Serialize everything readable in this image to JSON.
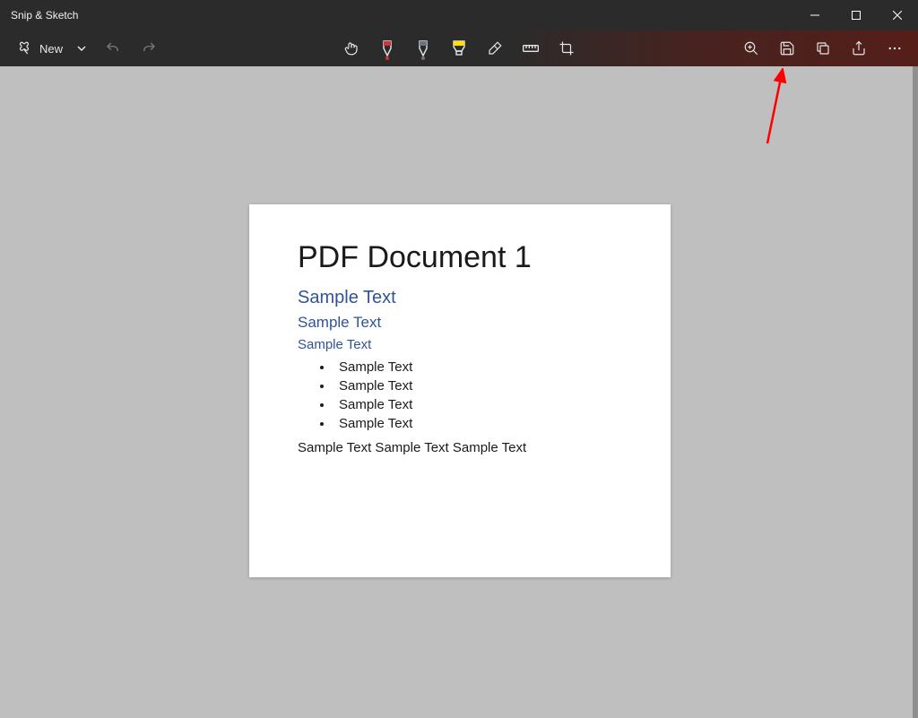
{
  "app": {
    "title": "Snip & Sketch"
  },
  "toolbar": {
    "new_label": "New",
    "tools": {
      "touch": "touch-writing",
      "ballpoint": {
        "name": "ballpoint-pen",
        "color": "#d13438"
      },
      "pencil": {
        "name": "pencil",
        "color": "#30363d"
      },
      "highlighter": {
        "name": "highlighter",
        "color": "#ffe100"
      },
      "eraser": "eraser",
      "ruler": "ruler",
      "crop": "crop"
    },
    "right": {
      "zoom": "zoom",
      "save": "save",
      "copy": "copy",
      "share": "share",
      "more": "more"
    }
  },
  "document": {
    "title": "PDF Document 1",
    "heading2": "Sample Text",
    "heading3": "Sample Text",
    "heading4": "Sample Text",
    "bullets": [
      "Sample Text",
      "Sample Text",
      "Sample Text",
      "Sample Text"
    ],
    "paragraph": "Sample Text Sample Text Sample Text"
  }
}
